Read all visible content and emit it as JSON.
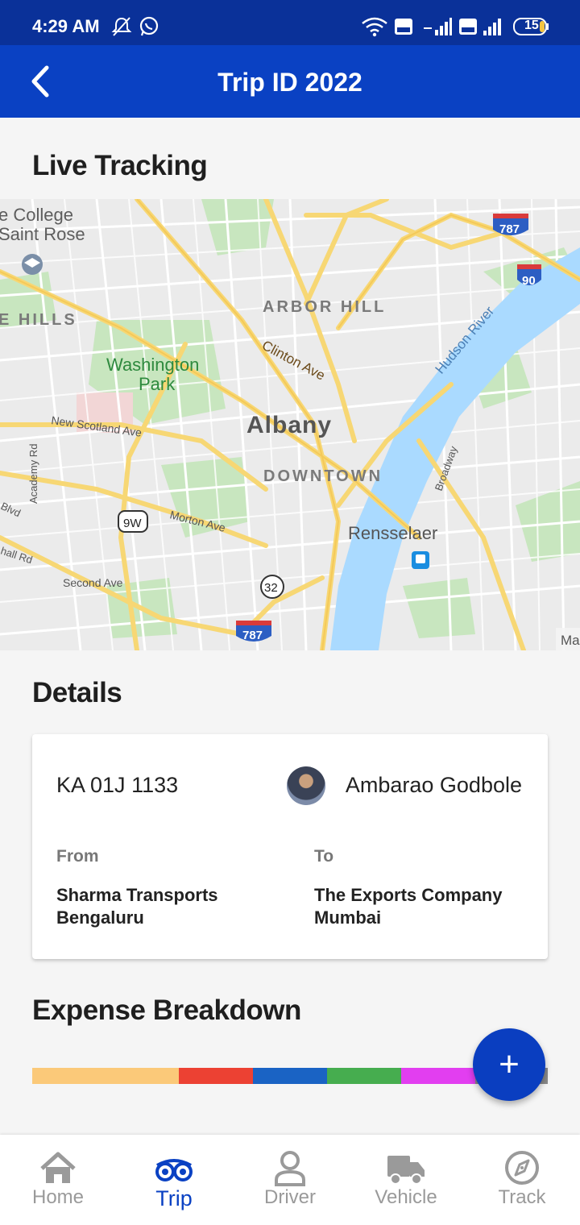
{
  "status_bar": {
    "time": "4:29 AM",
    "battery": "15"
  },
  "app_bar": {
    "title": "Trip ID 2022"
  },
  "live_tracking": {
    "heading": "Live Tracking",
    "map_labels": {
      "college": "e College",
      "saint_rose": "Saint Rose",
      "hills": "E HILLS",
      "arbor_hill": "ARBOR HILL",
      "clinton_ave": "Clinton Ave",
      "washington_park_1": "Washington",
      "washington_park_2": "Park",
      "hudson_river": "Hudson River",
      "new_scotland": "New Scotland Ave",
      "albany": "Albany",
      "downtown": "DOWNTOWN",
      "academy_rd": "Academy Rd",
      "broadway": "Broadway",
      "blvd": "Blvd",
      "morton_ave": "Morton Ave",
      "rensselaer": "Rensselaer",
      "hall_rd": "hall Rd",
      "second_ave": "Second Ave",
      "rt_9w": "9W",
      "rt_32": "32",
      "i_787_top": "787",
      "i_787_bottom": "787",
      "i_90": "90",
      "ma": "Ma"
    }
  },
  "details": {
    "heading": "Details",
    "vehicle_number": "KA 01J 1133",
    "driver_name": "Ambarao Godbole",
    "from_label": "From",
    "from_line1": "Sharma Transports",
    "from_line2": "Bengaluru",
    "to_label": "To",
    "to_line1": "The Exports Company",
    "to_line2": "Mumbai"
  },
  "expense": {
    "heading": "Expense Breakdown",
    "segments": [
      {
        "color": "#fbc979",
        "share": 0.284
      },
      {
        "color": "#ec4133",
        "share": 0.144
      },
      {
        "color": "#1a63c4",
        "share": 0.144
      },
      {
        "color": "#46ad4f",
        "share": 0.144
      },
      {
        "color": "#e23ef0",
        "share": 0.144
      },
      {
        "color": "#8a8a8a",
        "share": 0.14
      }
    ]
  },
  "fab": {
    "symbol": "+"
  },
  "bottom_nav": {
    "active": "trip",
    "items": [
      {
        "id": "home",
        "label": "Home",
        "icon": "home-icon"
      },
      {
        "id": "trip",
        "label": "Trip",
        "icon": "trip-binoculars-icon"
      },
      {
        "id": "driver",
        "label": "Driver",
        "icon": "driver-person-icon"
      },
      {
        "id": "vehicle",
        "label": "Vehicle",
        "icon": "truck-icon"
      },
      {
        "id": "track",
        "label": "Track",
        "icon": "compass-icon"
      }
    ]
  },
  "colors": {
    "status_bar": "#0a3199",
    "app_bar": "#0a41c3",
    "accent": "#0a41c3",
    "inactive": "#9a9a9a"
  }
}
